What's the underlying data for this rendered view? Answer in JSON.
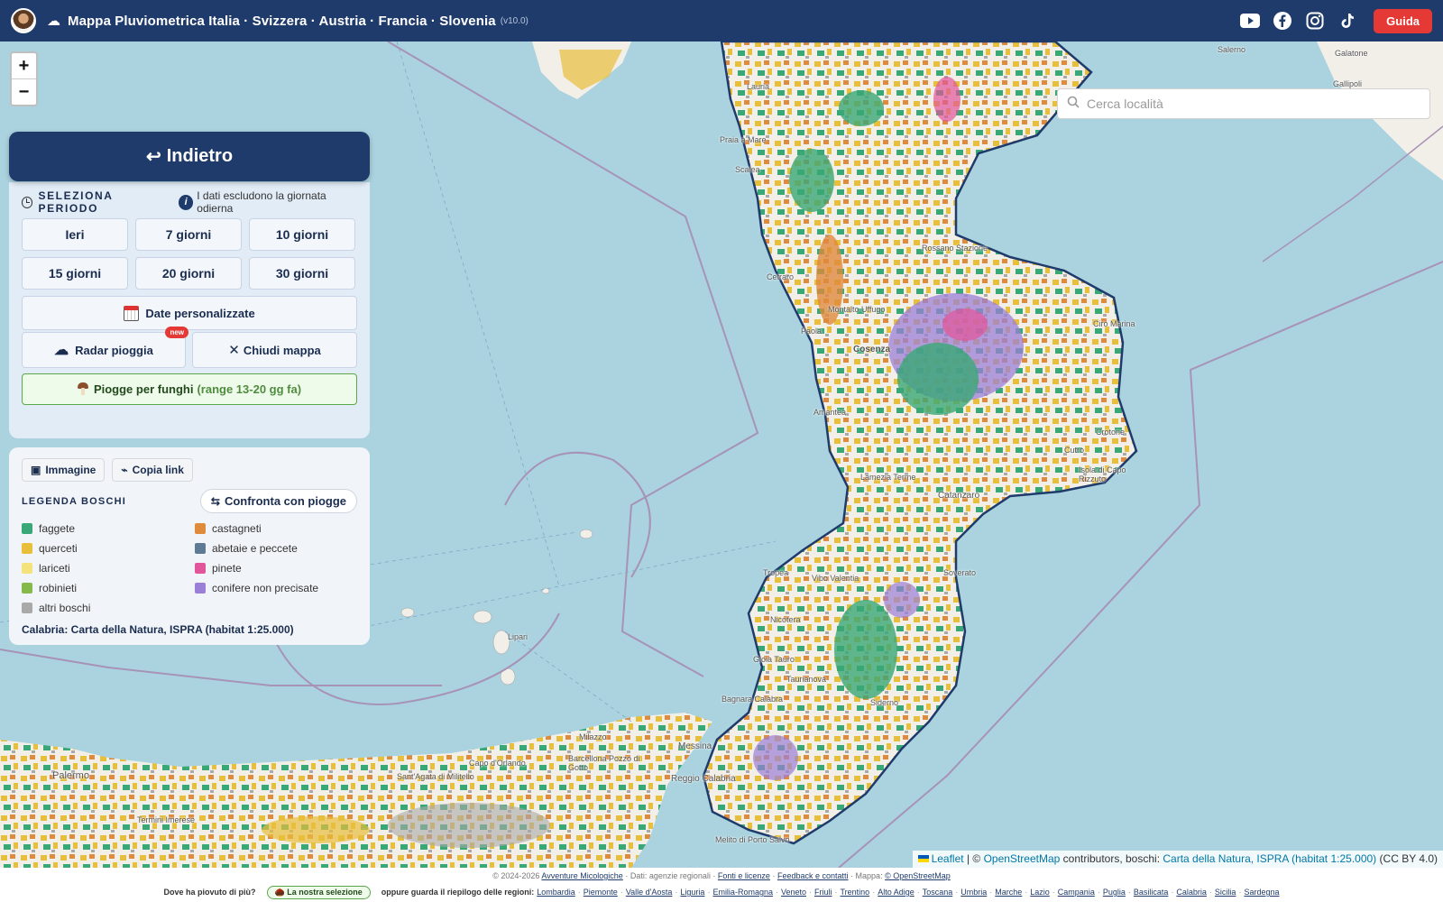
{
  "header": {
    "title": "Mappa Pluviometrica Italia · Svizzera · Austria · Francia · Slovenia",
    "version": "(v10.0)",
    "guide_label": "Guida",
    "icons": [
      "youtube-icon",
      "facebook-icon",
      "instagram-icon",
      "tiktok-icon"
    ]
  },
  "map": {
    "zoom_in": "+",
    "zoom_out": "−",
    "search_placeholder": "Cerca località",
    "places": [
      "Salerno",
      "Galatone",
      "Gallipoli",
      "Lauria",
      "Praia a Mare",
      "Scalea",
      "Rossano Stazione",
      "Cetraro",
      "Paola",
      "Montalto Uffugo",
      "Cosenza",
      "Cirò Marina",
      "Amantea",
      "Crotone",
      "Cutro",
      "Isola di Capo Rizzuto",
      "Lamezia Terme",
      "Catanzaro",
      "Tropea",
      "Vibo Valentia",
      "Soverato",
      "Nicotera",
      "Gioia Tauro",
      "Taurianova",
      "Siderno",
      "Bagnara Calabra",
      "Lipari",
      "Milazzo",
      "Barcellona Pozzo di Gotto",
      "Messina",
      "Reggio Calabria",
      "Palermo",
      "Sant'Agata di Militello",
      "Termini Imerese",
      "Capo d'Orlando",
      "Melito di Porto Salvo"
    ]
  },
  "back_button": "Indietro",
  "period": {
    "title": "SELEZIONA PERIODO",
    "note": "I dati escludono la giornata odierna",
    "buttons": [
      "Ieri",
      "7 giorni",
      "10 giorni",
      "15 giorni",
      "20 giorni",
      "30 giorni"
    ],
    "custom_dates": "Date personalizzate",
    "radar": "Radar pioggia",
    "new_badge": "new",
    "close_map": "Chiudi mappa",
    "funghi": "Piogge per funghi",
    "funghi_range": "(range 13-20 gg fa)"
  },
  "legend": {
    "image_btn": "Immagine",
    "copy_link_btn": "Copia link",
    "title": "LEGENDA BOSCHI",
    "compare_btn": "Confronta con piogge",
    "items": [
      {
        "label": "faggete",
        "color": "#3aa876"
      },
      {
        "label": "castagneti",
        "color": "#e08a3c"
      },
      {
        "label": "querceti",
        "color": "#e8bf3a"
      },
      {
        "label": "abetaie e peccete",
        "color": "#5f7a94"
      },
      {
        "label": "lariceti",
        "color": "#f4e27a"
      },
      {
        "label": "pinete",
        "color": "#e2559a"
      },
      {
        "label": "robinieti",
        "color": "#86b94c"
      },
      {
        "label": "conifere non precisate",
        "color": "#9b7fd6"
      },
      {
        "label": "altri boschi",
        "color": "#a9a9a9"
      }
    ],
    "source": "Calabria: Carta della Natura, ISPRA (habitat 1:25.000)"
  },
  "attribution": {
    "leaflet": "Leaflet",
    "sep": "| ©",
    "osm": "OpenStreetMap",
    "contrib": "contributors, boschi:",
    "cdn": "Carta della Natura, ISPRA (habitat 1:25.000)",
    "license": "(CC BY 4.0)"
  },
  "footer": {
    "copyright": "© 2024-2026",
    "site": "Avventure Micologiche",
    "data_src": "· Dati: agenzie regionali ·",
    "fonti": "Fonti e licenze",
    "dot1": "·",
    "feedback": "Feedback e contatti",
    "mappa": "· Mappa:",
    "osm": "© OpenStreetMap",
    "question": "Dove ha piovuto di più?",
    "selection": "🌰 La nostra selezione",
    "or_text": "oppure guarda il riepilogo delle regioni:",
    "regions": [
      "Lombardia",
      "Piemonte",
      "Valle d'Aosta",
      "Liguria",
      "Emilia-Romagna",
      "Veneto",
      "Friuli",
      "Trentino",
      "Alto Adige",
      "Toscana",
      "Umbria",
      "Marche",
      "Lazio",
      "Campania",
      "Puglia",
      "Basilicata",
      "Calabria",
      "Sicilia",
      "Sardegna"
    ]
  },
  "colors": {
    "header_bg": "#1f3b6b",
    "guide_btn": "#e53935",
    "sea": "#aad3df",
    "land": "#f2efe9"
  }
}
